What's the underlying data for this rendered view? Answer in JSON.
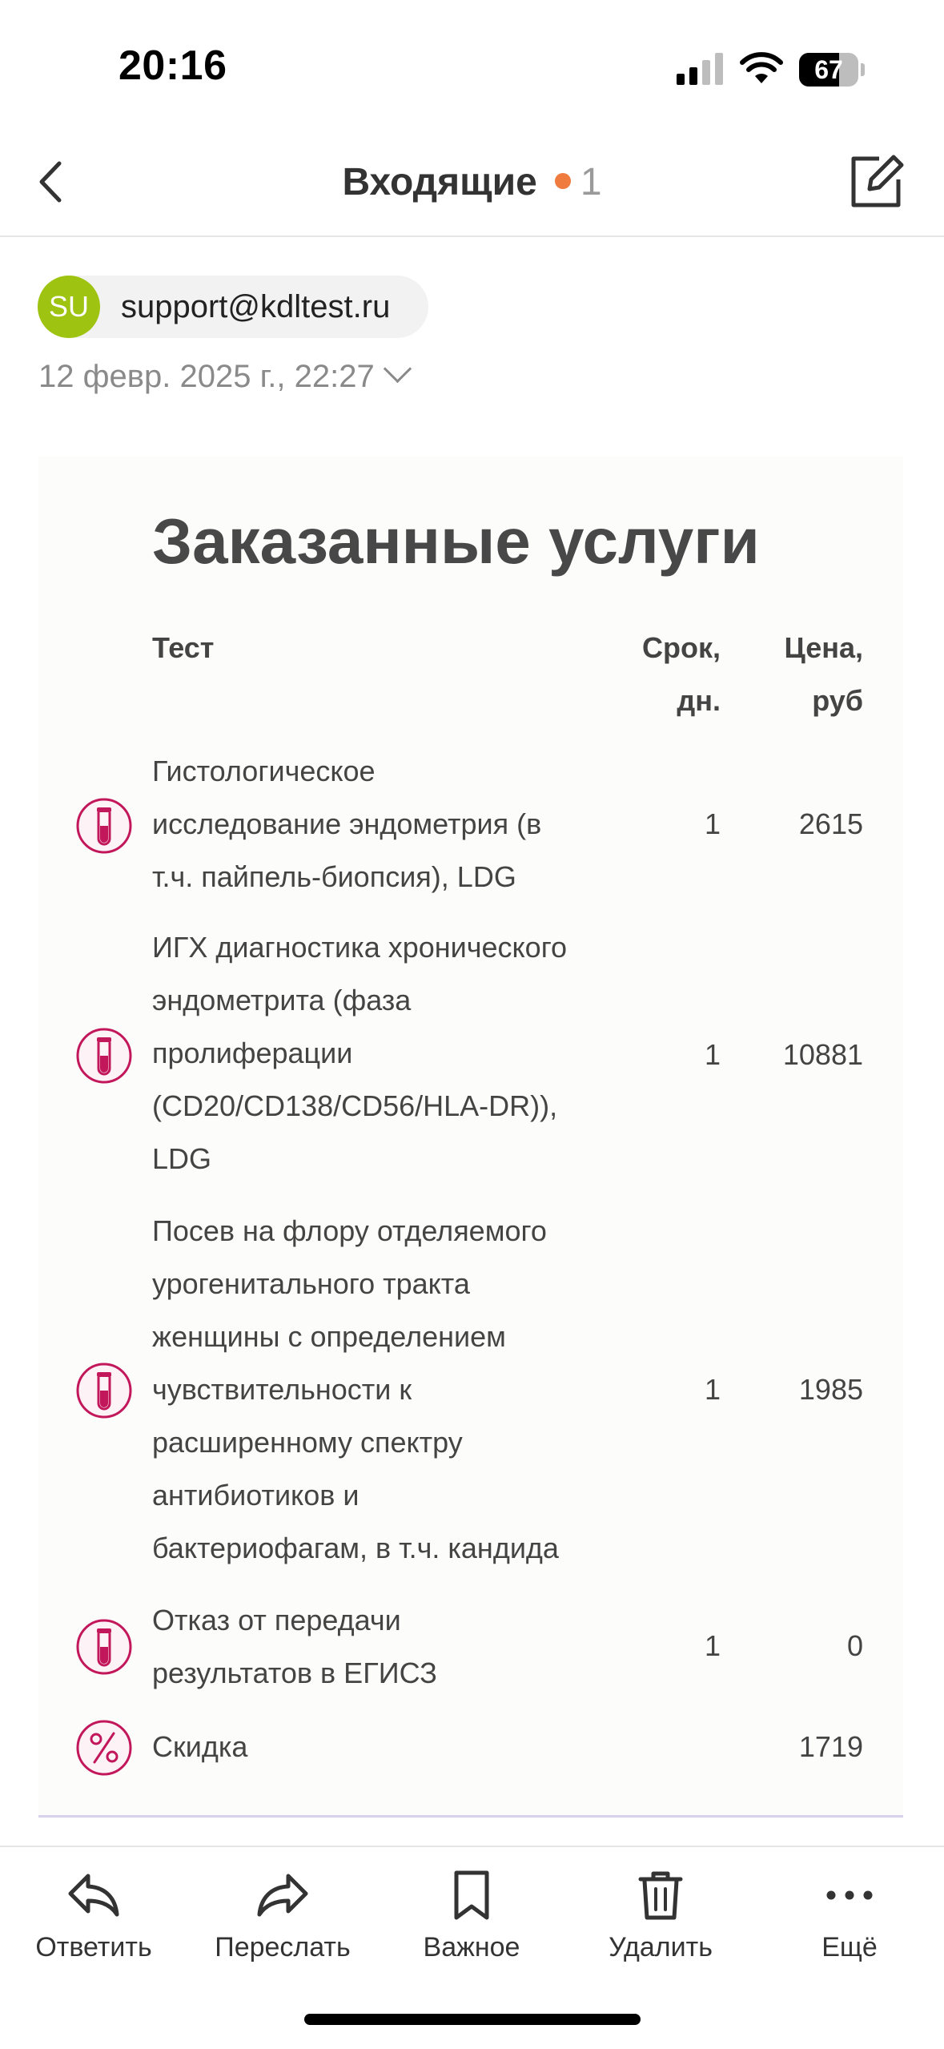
{
  "status_bar": {
    "time": "20:16",
    "battery": "67",
    "battery_level": 0.67
  },
  "header": {
    "title": "Входящие",
    "unread_count": "1"
  },
  "message": {
    "avatar_initials": "SU",
    "avatar_color": "#9fc311",
    "sender_email": "support@kdltest.ru",
    "datetime": "12 февр. 2025 г., 22:27"
  },
  "order": {
    "title": "Заказанные услуги",
    "columns": {
      "test": "Тест",
      "days": [
        "Срок,",
        "дн."
      ],
      "price": [
        "Цена,",
        "руб"
      ]
    },
    "rows": [
      {
        "lines": [
          "Гистологическое",
          "исследование эндометрия (в",
          "т.ч. пайпель-биопсия), LDG"
        ],
        "days": "1",
        "price": "2615",
        "icon": "test-tube-icon"
      },
      {
        "lines": [
          "ИГХ диагностика хронического",
          "эндометрита (фаза",
          "пролиферации",
          "(CD20/CD138/CD56/HLA-DR)),",
          "LDG"
        ],
        "days": "1",
        "price": "10881",
        "icon": "test-tube-icon"
      },
      {
        "lines": [
          "Посев на флору отделяемого",
          "урогенитального тракта",
          "женщины с определением",
          "чувствительности к",
          "расширенному спектру",
          "антибиотиков и",
          "бактериофагам, в т.ч. кандида"
        ],
        "days": "1",
        "price": "1985",
        "icon": "test-tube-icon"
      },
      {
        "lines": [
          "Отказ от передачи",
          "результатов в ЕГИСЗ"
        ],
        "days": "1",
        "price": "0",
        "icon": "test-tube-icon"
      }
    ],
    "discount": {
      "label": "Скидка",
      "value": "1719",
      "icon": "percent-icon"
    },
    "accent_color": "#c2185b"
  },
  "toolbar": {
    "reply": "Ответить",
    "forward": "Переслать",
    "important": "Важное",
    "delete": "Удалить",
    "more": "Ещё"
  }
}
